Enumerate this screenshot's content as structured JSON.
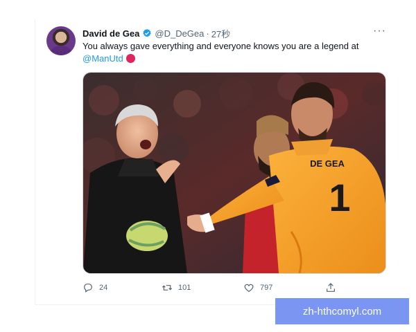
{
  "tweet": {
    "display_name": "David de Gea",
    "handle": "@D_DeGea",
    "separator": "·",
    "time": "27秒",
    "more_label": "···",
    "text": "You always gave everything and everyone knows you are a legend at",
    "mention": "@ManUtd",
    "photo": {
      "jersey_text": "DE GEA",
      "jersey_number": "1"
    },
    "stats": {
      "replies": "24",
      "retweets": "101",
      "likes": "797"
    }
  },
  "watermark": "zh-hthcomyl.com",
  "colors": {
    "link": "#1d9bf0",
    "muted": "#536471",
    "verified": "#1d9bf0",
    "jersey": "#f6a023",
    "watermark_bg": "#7b95f2"
  },
  "icons": [
    "verified-badge-icon",
    "more-icon",
    "red-circle-emoji",
    "reply-icon",
    "retweet-icon",
    "like-icon",
    "share-icon"
  ]
}
